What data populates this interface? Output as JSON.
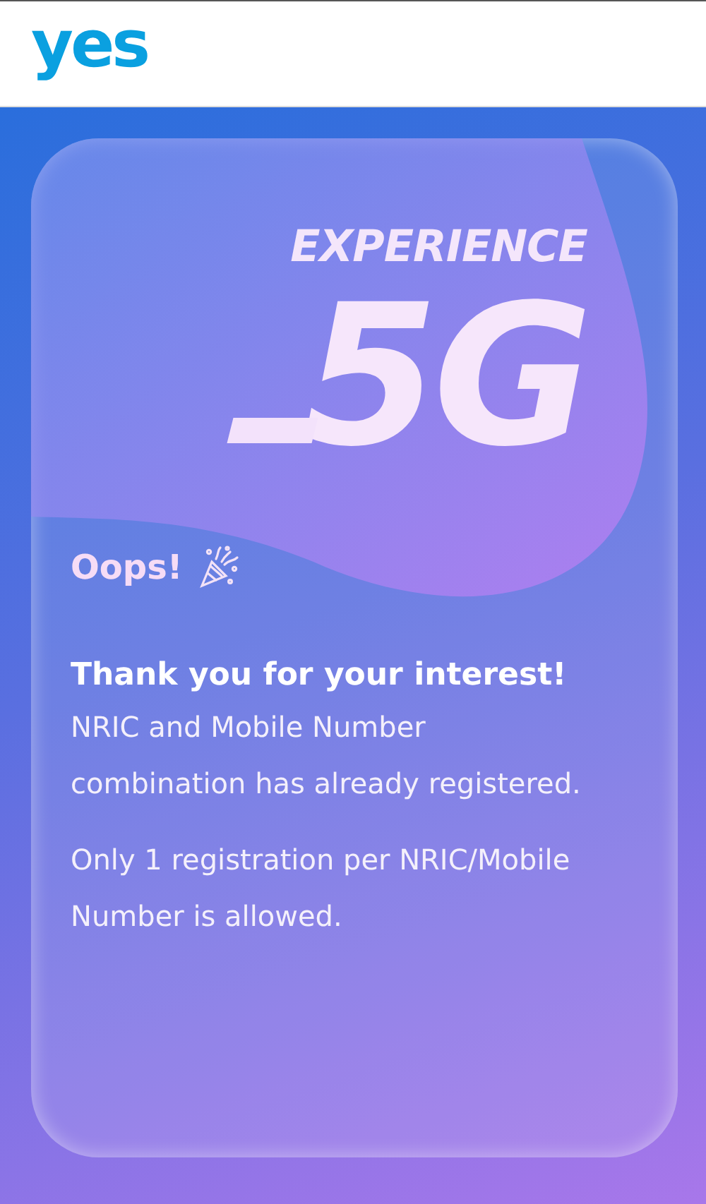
{
  "header": {
    "logo": "yes"
  },
  "card": {
    "tagline": "EXPERIENCE",
    "headline": "5G",
    "title": "Oops!",
    "heading": "Thank you for your interest!",
    "paragraphs": [
      "NRIC and Mobile Number combination has already registered.",
      "Only 1 registration per NRIC/Mobile Number is allowed."
    ]
  }
}
